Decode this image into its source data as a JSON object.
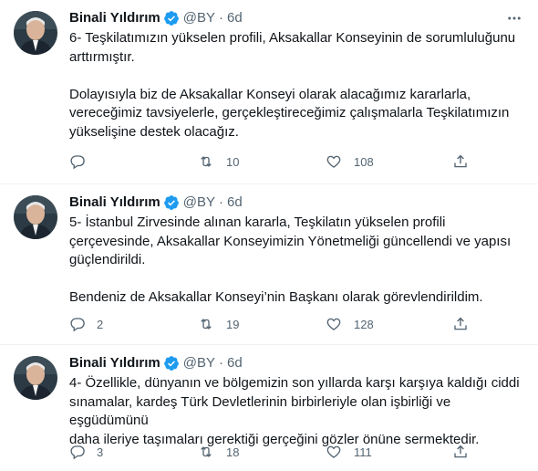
{
  "tweets": [
    {
      "author": "Binali Yıldırım",
      "handle": "@BY",
      "separator": "·",
      "time": "6d",
      "text": "6- Teşkilatımızın yükselen profili, Aksakallar Konseyinin de sorumluluğunu\narttırmıştır.\n\nDolayısıyla biz de Aksakallar Konseyi olarak alacağımız kararlarla,\nvereceğimiz tavsiyelerle, gerçekleştireceğimiz çalışmalarla Teşkilatımızın\nyükselişine destek olacağız.",
      "replies": "",
      "retweets": "10",
      "likes": "108"
    },
    {
      "author": "Binali Yıldırım",
      "handle": "@BY",
      "separator": "·",
      "time": "6d",
      "text": "5- İstanbul Zirvesinde alınan kararla, Teşkilatın yükselen profili\nçerçevesinde, Aksakallar Konseyimizin Yönetmeliği güncellendi ve yapısı\ngüçlendirildi.\n\nBendeniz de Aksakallar Konseyi’nin Başkanı olarak görevlendirildim.",
      "replies": "2",
      "retweets": "19",
      "likes": "128"
    },
    {
      "author": "Binali Yıldırım",
      "handle": "@BY",
      "separator": "·",
      "time": "6d",
      "text": "4- Özellikle, dünyanın ve bölgemizin son yıllarda karşı karşıya kaldığı ciddi\nsınamalar, kardeş Türk Devletlerinin birbirleriyle olan işbirliği ve eşgüdümünü\ndaha ileriye taşımaları gerektiği gerçeğini gözler önüne sermektedir.",
      "replies": "3",
      "retweets": "18",
      "likes": "111"
    }
  ],
  "icons": {
    "verified": "verified-badge-icon",
    "more": "more-dots-icon",
    "reply": "reply-icon",
    "retweet": "retweet-icon",
    "like": "heart-icon",
    "share": "share-icon"
  },
  "colors": {
    "text": "#0f1419",
    "secondary": "#536471",
    "verified": "#1d9bf0",
    "divider": "#eff3f4"
  }
}
